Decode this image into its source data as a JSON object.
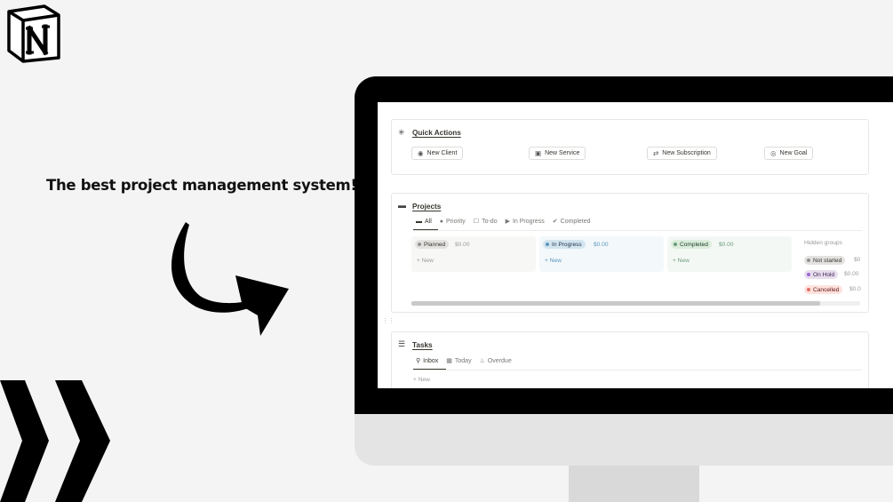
{
  "headline": "The best project management system!",
  "colors": {
    "accent_dark": "#111111",
    "monitor": "#000000",
    "stand": "#d9d9d9"
  },
  "icons": {
    "logo": "notion-logo",
    "arrow": "curved-arrow-icon",
    "chevrons": "chevrons-right-icon"
  },
  "quick_actions": {
    "title": "Quick Actions",
    "buttons": [
      {
        "label": "New Client",
        "icon": "person-icon"
      },
      {
        "label": "New Service",
        "icon": "box-icon"
      },
      {
        "label": "New Subscription",
        "icon": "repeat-icon"
      },
      {
        "label": "New Goal",
        "icon": "target-icon"
      }
    ]
  },
  "projects": {
    "title": "Projects",
    "tabs": [
      {
        "label": "All",
        "icon": "folder-icon",
        "active": true
      },
      {
        "label": "Priority",
        "icon": "alert-icon"
      },
      {
        "label": "To-do",
        "icon": "checkbox-icon"
      },
      {
        "label": "In Progress",
        "icon": "play-icon"
      },
      {
        "label": "Completed",
        "icon": "check-circle-icon"
      }
    ],
    "columns": [
      {
        "label": "Planned",
        "sum": "$0.00",
        "new": "New"
      },
      {
        "label": "In Progress",
        "sum": "$0.00",
        "new": "New"
      },
      {
        "label": "Completed",
        "sum": "$0.00",
        "new": "New"
      }
    ],
    "hidden_groups_label": "Hidden groups",
    "hidden_groups": [
      {
        "label": "Not started",
        "sum": "$0"
      },
      {
        "label": "On Hold",
        "sum": "$0.00"
      },
      {
        "label": "Cancelled",
        "sum": "$0.0"
      }
    ]
  },
  "tasks": {
    "title": "Tasks",
    "tabs": [
      {
        "label": "Inbox",
        "icon": "inbox-icon",
        "active": true
      },
      {
        "label": "Today",
        "icon": "calendar-icon"
      },
      {
        "label": "Overdue",
        "icon": "fire-icon"
      }
    ],
    "new": "New"
  }
}
